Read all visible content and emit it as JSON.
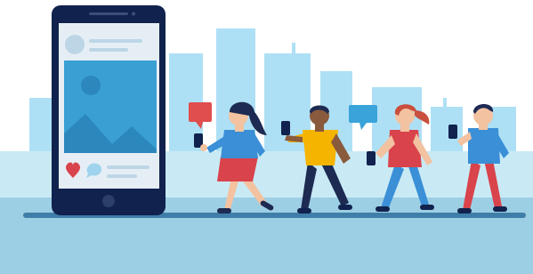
{
  "scene": {
    "colors": {
      "background": "#ffffff",
      "skyline": "#aee0f5",
      "ground": "#9dcfe4",
      "ground_light": "#c9eaf5",
      "floor_line": "#3f7ea8",
      "phone_body": "#10224d",
      "phone_screen": "#e6eef5",
      "post_image": "#3a9fd3",
      "heart": "#d9434b",
      "bubble_red": "#e04e4e",
      "bubble_blue": "#3aa3da",
      "skin_light": "#f3c2a0",
      "skin_dark": "#8a5a3c"
    },
    "icons": {
      "phone": "smartphone-icon",
      "like": "heart-icon",
      "comment": "chat-bubble-icon",
      "image": "image-placeholder-icon"
    },
    "people": [
      {
        "name": "woman-red-skirt",
        "shirt": "#3a8fd6",
        "bottom": "#d9434b",
        "hair": "#1d2a52"
      },
      {
        "name": "man-yellow-shirt",
        "shirt": "#f4b400",
        "bottom": "#1d2a52",
        "hair": "#1d2a52"
      },
      {
        "name": "woman-red-top",
        "shirt": "#d9434b",
        "bottom": "#3a8fd6",
        "hair": "#c94f3e"
      },
      {
        "name": "man-blue-shirt",
        "shirt": "#3a8fd6",
        "bottom": "#d9434b",
        "hair": "#1d2a52"
      }
    ]
  }
}
